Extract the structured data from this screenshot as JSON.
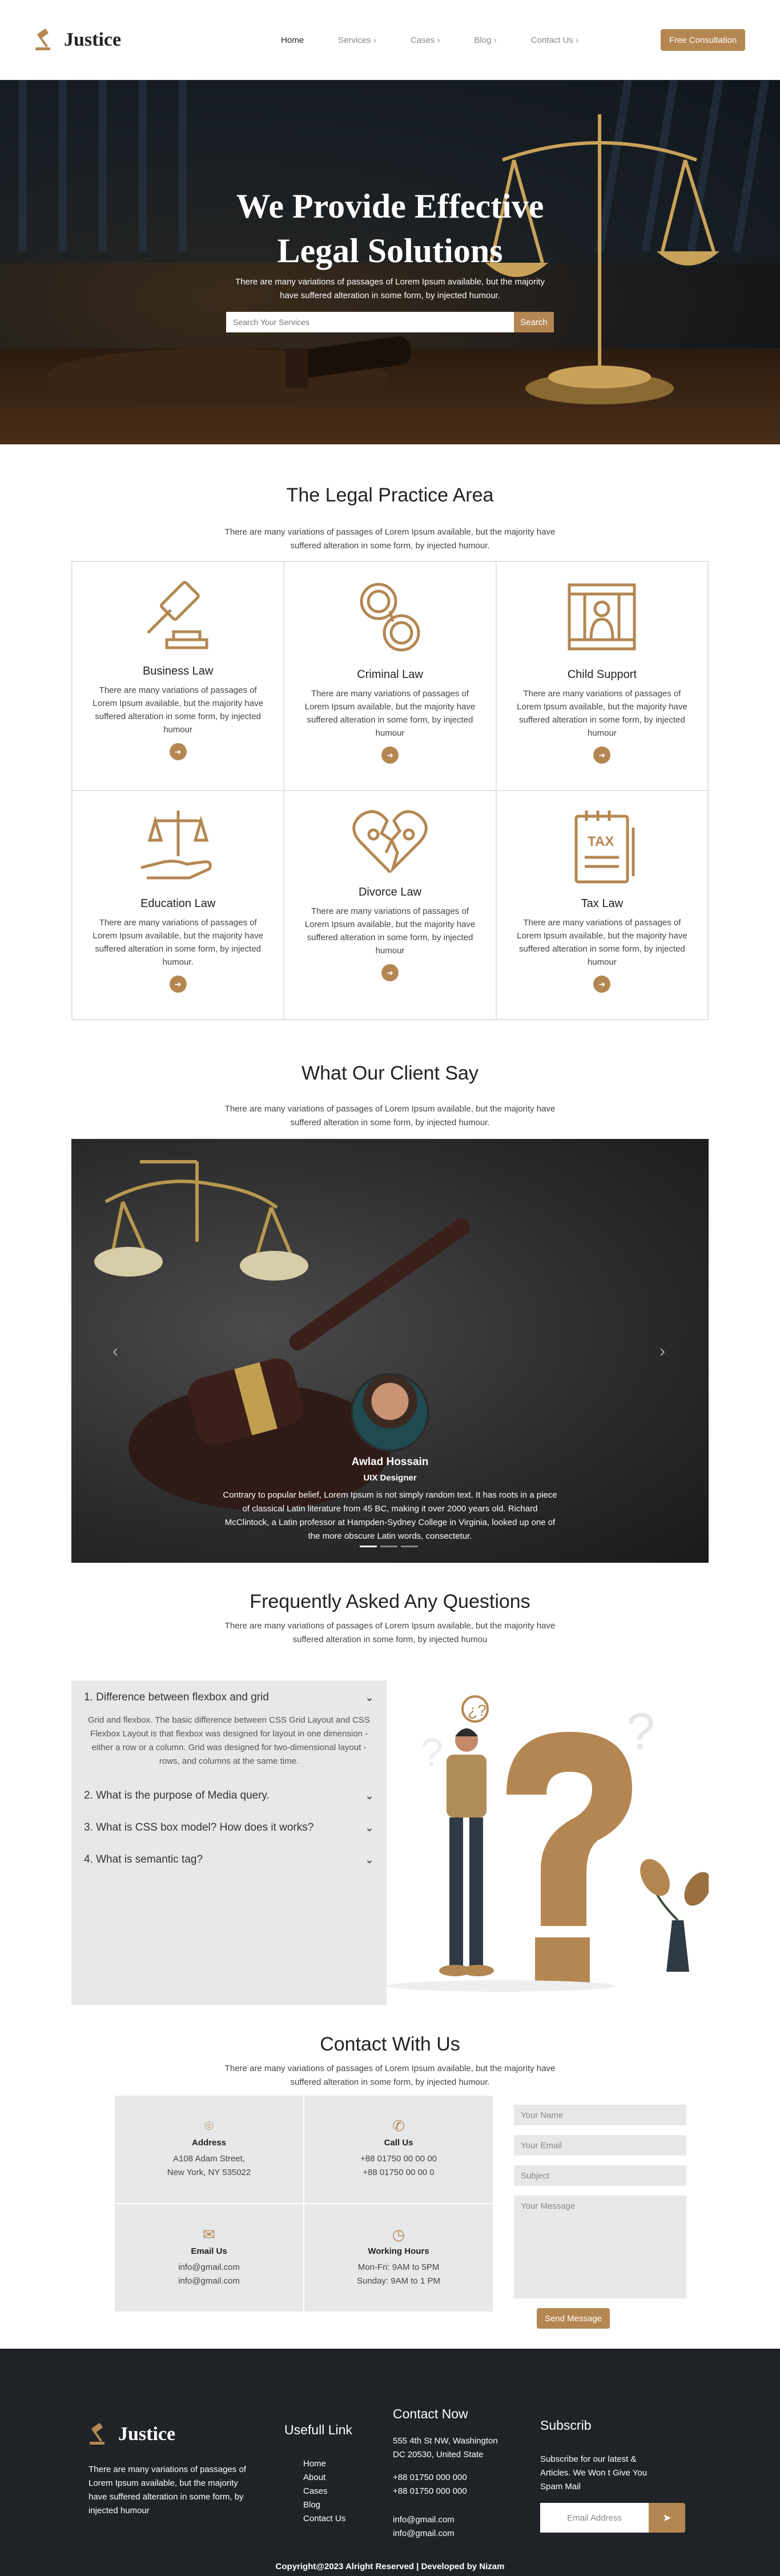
{
  "header": {
    "logo": "Justice",
    "nav": [
      "Home",
      "Services",
      "Cases",
      "Blog",
      "Contact Us"
    ],
    "cta": "Free Consultation"
  },
  "hero": {
    "title_line1": "We Provide Effective",
    "title_line2": "Legal Solutions",
    "subtitle": "There are many variations of passages of Lorem Ipsum available, but the majority have suffered alteration in some form, by injected humour.",
    "search_placeholder": "Search Your Services",
    "search_button": "Search"
  },
  "practice": {
    "title": "The Legal Practice Area",
    "subtitle": "There are many variations of passages of Lorem Ipsum available, but the majority have suffered alteration in some form, by injected humour.",
    "cards": [
      {
        "title": "Business Law",
        "text": "There are many variations of passages of Lorem Ipsum available, but the majority have suffered alteration in some form, by injected humour",
        "icon": "gavel-icon"
      },
      {
        "title": "Criminal Law",
        "text": "There are many variations of passages of Lorem Ipsum available, but the majority have suffered alteration in some form, by injected humour",
        "icon": "handcuffs-icon"
      },
      {
        "title": "Child Support",
        "text": "There are many variations of passages of Lorem Ipsum available, but the majority have suffered alteration in some form, by injected humour",
        "icon": "prison-icon"
      },
      {
        "title": "Education Law",
        "text": "There are many variations of passages of Lorem Ipsum available, but the majority have suffered alteration in some form, by injected humour.",
        "icon": "scales-hand-icon"
      },
      {
        "title": "Divorce Law",
        "text": "There are many variations of passages of Lorem Ipsum available, but the majority have suffered alteration in some form, by injected humour",
        "icon": "broken-heart-icon"
      },
      {
        "title": "Tax Law",
        "text": "There are many variations of passages of Lorem Ipsum available, but the majority have suffered alteration in some form, by injected humour",
        "icon": "tax-document-icon"
      }
    ]
  },
  "testimonials": {
    "title": "What Our Client Say",
    "subtitle": "There are many variations of passages of Lorem Ipsum available, but the majority have suffered alteration in some form, by injected humour.",
    "name": "Awlad Hossain",
    "role": "UIX Designer",
    "quote": "Contrary to popular belief, Lorem Ipsum is not simply random text. It has roots in a piece of classical Latin literature from 45 BC, making it over 2000 years old. Richard McClintock, a Latin professor at Hampden-Sydney College in Virginia, looked up one of the more obscure Latin words, consectetur."
  },
  "faq": {
    "title": "Frequently Asked Any Questions",
    "subtitle": "There are many variations of passages of Lorem Ipsum available, but the majority have suffered alteration in some form, by injected humou",
    "items": [
      {
        "q": "1. Difference between flexbox and grid",
        "a": "Grid and flexbox. The basic difference between CSS Grid Layout and CSS Flexbox Layout is that flexbox was designed for layout in one dimension - either a row or a column. Grid was designed for two-dimensional layout - rows, and columns at the same time."
      },
      {
        "q": "2. What is the purpose of Media query."
      },
      {
        "q": "3. What is CSS box model? How does it works?"
      },
      {
        "q": "4. What is semantic tag?"
      }
    ]
  },
  "contact": {
    "title": "Contact With Us",
    "subtitle": "There are many variations of passages of Lorem Ipsum available, but the majority have suffered alteration in some form, by injected humour.",
    "address_label": "Address",
    "address_1": "A108 Adam Street,",
    "address_2": "New York, NY 535022",
    "call_label": "Call Us",
    "call_1": "+88 01750 00 00 00",
    "call_2": "+88 01750 00 00 0",
    "email_label": "Email Us",
    "email_1": "info@gmail.com",
    "email_2": "info@gmail.com",
    "hours_label": "Working Hours",
    "hours_1": "Mon-Fri: 9AM to 5PM",
    "hours_2": "Sunday: 9AM to 1 PM",
    "form": {
      "name": "Your Name",
      "email": "Your Email",
      "subject": "Subject",
      "message": "Your Message",
      "send": "Send Message"
    }
  },
  "footer": {
    "logo": "Justice",
    "about": "There are many variations of passages of Lorem Ipsum available, but the majority have suffered alteration in some form, by injected humour",
    "links_title": "Usefull Link",
    "links": [
      "Home",
      "About",
      "Cases",
      "Blog",
      "Contact Us"
    ],
    "contact_title": "Contact Now",
    "address": "555 4th St NW, Washington DC 20530, United State",
    "phone_1": "+88 01750 000 000",
    "phone_2": "+88 01750 000 000",
    "email_1": "info@gmail.com",
    "email_2": "info@gmail.com",
    "sub_title": "Subscrib",
    "sub_text": "Subscribe for our latest & Articles. We Won t Give You Spam Mail",
    "email_placeholder": "Email Address",
    "copyright": "Copyright@2023 Alright Reserved | Developed by Nizam"
  },
  "colors": {
    "accent": "#b48752",
    "dark": "#1f2327",
    "panel": "#e6e8ea"
  }
}
